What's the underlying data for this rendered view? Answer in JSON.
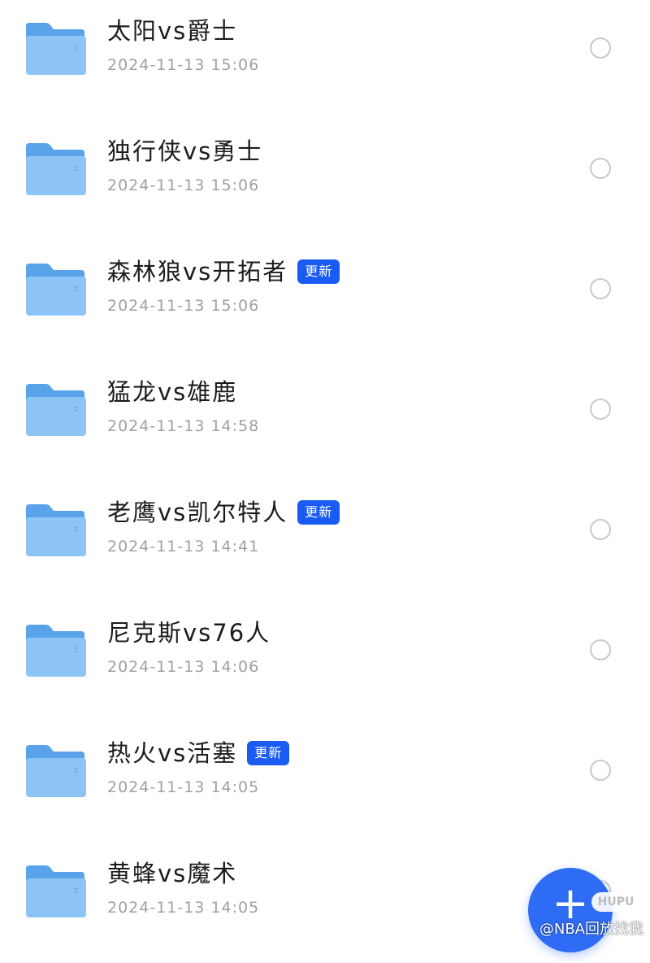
{
  "folders": [
    {
      "title": "太阳vs爵士",
      "date": "2024-11-13 15:06",
      "badge": ""
    },
    {
      "title": "独行侠vs勇士",
      "date": "2024-11-13 15:06",
      "badge": ""
    },
    {
      "title": "森林狼vs开拓者",
      "date": "2024-11-13 15:06",
      "badge": "更新"
    },
    {
      "title": "猛龙vs雄鹿",
      "date": "2024-11-13 14:58",
      "badge": ""
    },
    {
      "title": "老鹰vs凯尔特人",
      "date": "2024-11-13 14:41",
      "badge": "更新"
    },
    {
      "title": "尼克斯vs76人",
      "date": "2024-11-13 14:06",
      "badge": ""
    },
    {
      "title": "热火vs活塞",
      "date": "2024-11-13 14:05",
      "badge": "更新"
    },
    {
      "title": "黄蜂vs魔术",
      "date": "2024-11-13 14:05",
      "badge": ""
    }
  ],
  "fab": {
    "icon": "plus-icon"
  },
  "hupu_logo": "HUPU",
  "watermark": "@NBA回放找我",
  "colors": {
    "folder_back": "#5aa2ea",
    "folder_front": "#8cc4f6",
    "badge": "#1a5cf2",
    "fab": "#2e6cf5",
    "date_text": "#a0a0a0"
  }
}
